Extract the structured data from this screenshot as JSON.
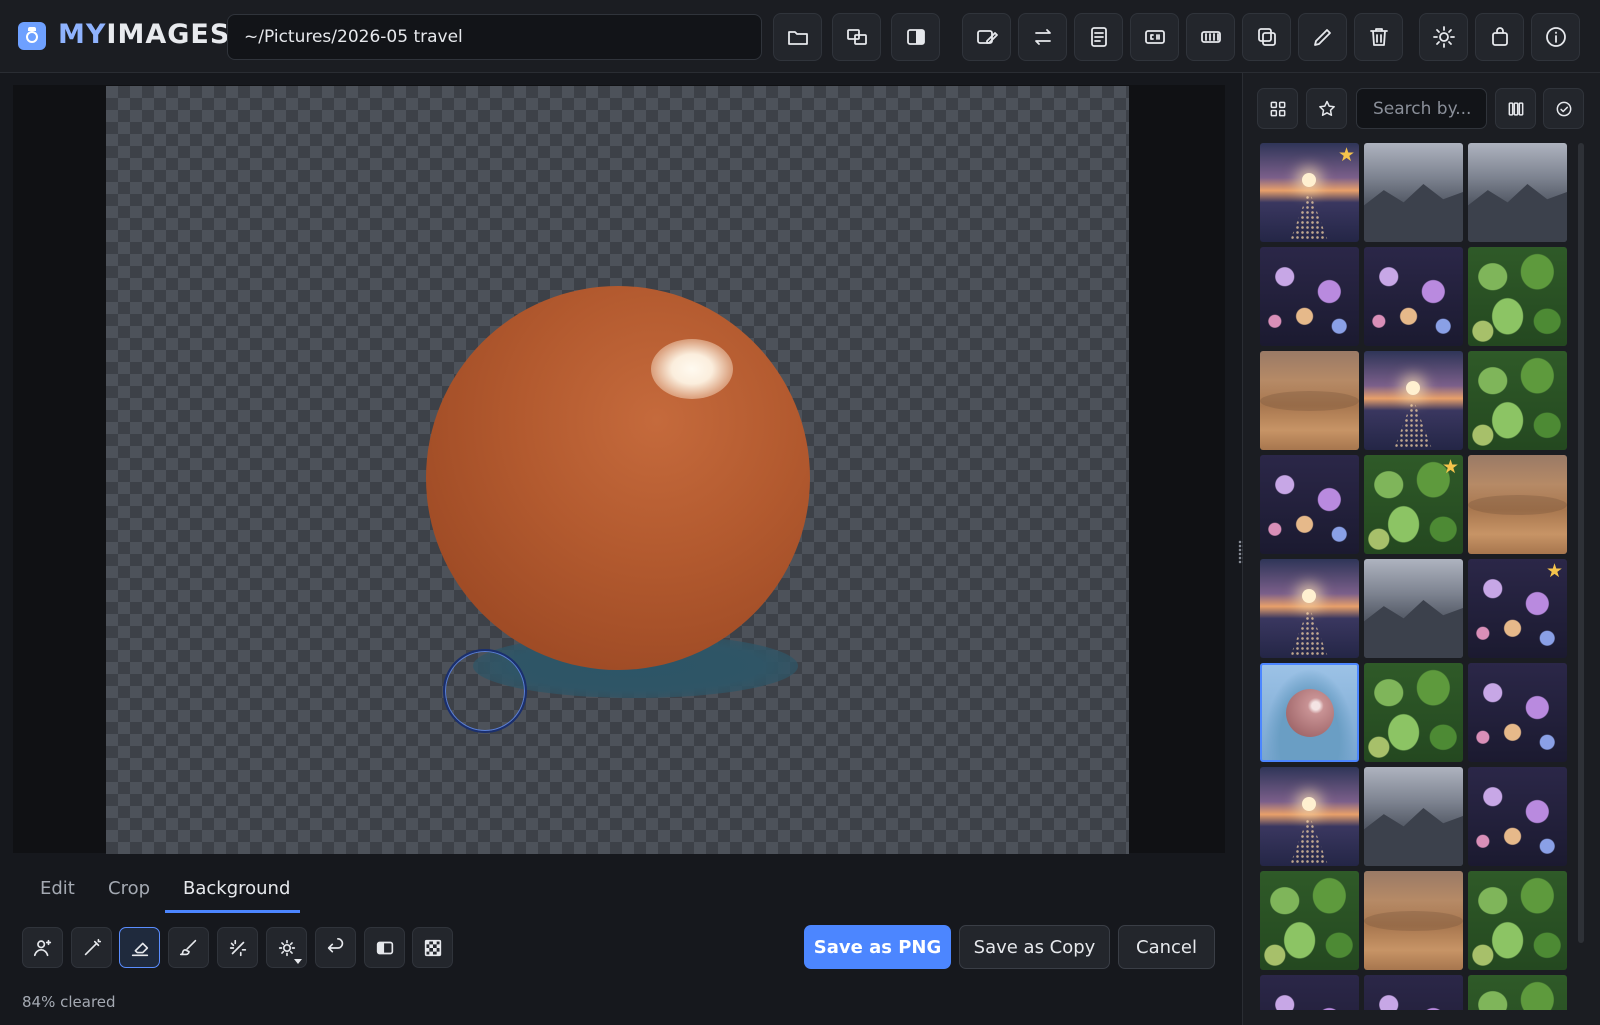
{
  "app": {
    "title_prefix": "MY",
    "title_suffix": "IMAGES"
  },
  "toolbar": {
    "path": "~/Pictures/2026-05 travel",
    "buttons": [
      "open-folder-icon",
      "compare-icon",
      "split-view-icon",
      "edit-image-icon",
      "swap-icon",
      "document-icon",
      "caption-icon",
      "filmstrip-icon",
      "duplicate-icon",
      "pencil-icon",
      "trash-icon",
      "brightness-icon",
      "bag-icon",
      "info-icon"
    ]
  },
  "editor": {
    "tabs": [
      "Edit",
      "Crop",
      "Background"
    ],
    "active_tab": "Background",
    "tools": [
      "person-select-icon",
      "magic-wand-icon",
      "eraser-icon",
      "brush-icon",
      "auto-remove-icon",
      "brightness-menu-icon",
      "undo-icon",
      "invert-icon",
      "transparency-icon"
    ],
    "active_tool": "eraser-icon",
    "save_png": "Save as PNG",
    "save_copy": "Save as Copy",
    "cancel": "Cancel",
    "status": "84% cleared"
  },
  "sidebar": {
    "search_placeholder": "Search by...",
    "buttons": [
      "grid-view-icon",
      "favorites-icon",
      "columns-icon",
      "select-all-icon"
    ],
    "thumbnails": [
      {
        "kind": "sunset",
        "starred": true
      },
      {
        "kind": "mountains",
        "starred": false
      },
      {
        "kind": "mountains",
        "starred": false
      },
      {
        "kind": "bokeh",
        "starred": false
      },
      {
        "kind": "bokeh",
        "starred": false
      },
      {
        "kind": "leaves",
        "starred": false
      },
      {
        "kind": "desert",
        "starred": false
      },
      {
        "kind": "sunset",
        "starred": false
      },
      {
        "kind": "leaves",
        "starred": false
      },
      {
        "kind": "bokeh",
        "starred": false
      },
      {
        "kind": "leaves",
        "starred": true
      },
      {
        "kind": "desert",
        "starred": false
      },
      {
        "kind": "sunset",
        "starred": false
      },
      {
        "kind": "mountains",
        "starred": false
      },
      {
        "kind": "bokeh",
        "starred": true
      },
      {
        "kind": "subject",
        "starred": false,
        "selected": true
      },
      {
        "kind": "leaves",
        "starred": false
      },
      {
        "kind": "bokeh",
        "starred": false
      },
      {
        "kind": "sunset",
        "starred": false
      },
      {
        "kind": "mountains",
        "starred": false
      },
      {
        "kind": "bokeh",
        "starred": false
      },
      {
        "kind": "leaves",
        "starred": false
      },
      {
        "kind": "desert",
        "starred": false
      },
      {
        "kind": "leaves",
        "starred": false
      },
      {
        "kind": "bokeh",
        "starred": false
      },
      {
        "kind": "bokeh",
        "starred": false
      },
      {
        "kind": "leaves",
        "starred": false
      }
    ]
  },
  "colors": {
    "accent": "#4c86ff",
    "star": "#f5c44c"
  }
}
